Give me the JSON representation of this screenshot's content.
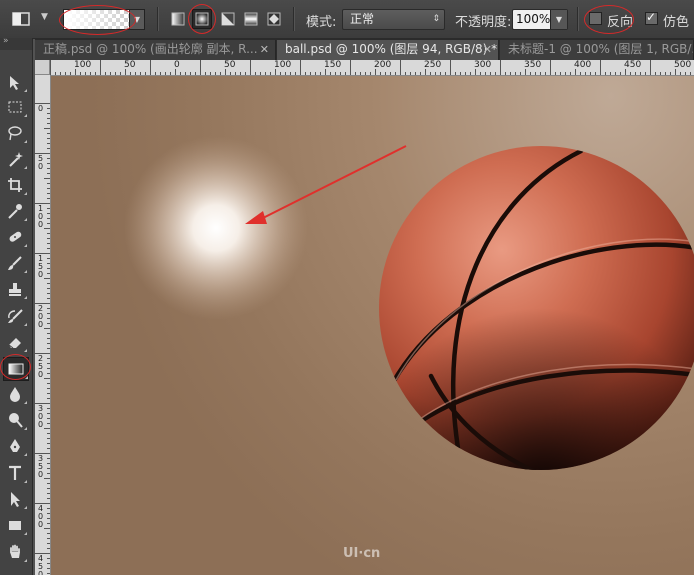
{
  "options_bar": {
    "mode_label": "模式:",
    "mode_value": "正常",
    "opacity_label": "不透明度:",
    "opacity_value": "100%",
    "reverse_label": "反向",
    "reverse_checked": false,
    "dither_label": "仿色",
    "dither_checked": true,
    "gradient_styles": [
      "linear-gradient-icon",
      "radial-gradient-icon",
      "angle-gradient-icon",
      "reflected-gradient-icon",
      "diamond-gradient-icon"
    ],
    "selected_gradient_style": "radial-gradient-icon"
  },
  "tabs": [
    {
      "label": "正稿.psd @ 100% (画出轮廓 副本, R...",
      "active": false
    },
    {
      "label": "ball.psd @ 100% (图层 94, RGB/8) *",
      "active": true
    },
    {
      "label": "未标题-1 @ 100% (图层 1, RGB/...",
      "active": false
    }
  ],
  "ruler_top": [
    "100",
    "50",
    "0",
    "50",
    "100",
    "150",
    "200",
    "250",
    "300",
    "350",
    "400",
    "450",
    "500"
  ],
  "ruler_left": [
    "0",
    "5\n0",
    "1\n0\n0",
    "1\n5\n0",
    "2\n0\n0",
    "2\n5\n0",
    "3\n0\n0",
    "3\n5\n0",
    "4\n0\n0",
    "4\n5\n0"
  ],
  "tools": [
    "move-tool-icon",
    "marquee-tool-icon",
    "lasso-tool-icon",
    "magic-wand-tool-icon",
    "crop-tool-icon",
    "eyedropper-tool-icon",
    "healing-brush-tool-icon",
    "brush-tool-icon",
    "clone-stamp-tool-icon",
    "history-brush-tool-icon",
    "eraser-tool-icon",
    "gradient-tool-icon",
    "blur-tool-icon",
    "dodge-tool-icon",
    "pen-tool-icon",
    "type-tool-icon",
    "path-selection-tool-icon",
    "rectangle-tool-icon",
    "hand-tool-icon"
  ],
  "selected_tool": "gradient-tool-icon",
  "watermark": "UI·cn",
  "colors": {
    "annotation_red": "#d42a2a",
    "arrow_red": "#e0302c",
    "ball_orange": "#c8684e",
    "canvas_tan": "#a5876d"
  }
}
